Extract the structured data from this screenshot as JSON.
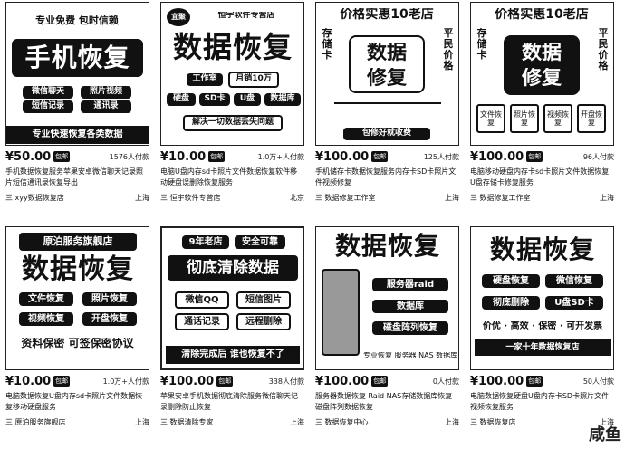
{
  "products": [
    {
      "thumb": {
        "top": "专业免费 包时信赖",
        "main": "手机恢复",
        "tags": [
          "微信聊天",
          "照片视频",
          "短信记录",
          "通讯录"
        ],
        "bottom": "专业快速恢复各类数据"
      },
      "price": "¥50.00",
      "badge": "包邮",
      "sold": "1576人付款",
      "title": "手机数据恢复服务苹果安卓微信聊天记录照片短信通讯录恢复导出",
      "shop": "三 xyy数据恢复店",
      "location": "上海"
    },
    {
      "thumb": {
        "logo": "宜聚",
        "shop": "恒宇软件专营店",
        "main": "数据恢复",
        "line1": "工作室",
        "line2": "月销10万",
        "tags": [
          "硬盘",
          "SD卡",
          "U盘",
          "数据库"
        ],
        "bottom": "解决一切数据丢失问题"
      },
      "price": "¥10.00",
      "badge": "包邮",
      "sold": "1.0万+人付款",
      "title": "电脑U盘内存sd卡照片文件数据恢复软件移动硬盘误删除恢复服务",
      "shop": "三 恒宇软件专营店",
      "location": "北京"
    },
    {
      "thumb": {
        "top": "价格实惠10老店",
        "left": "存储卡",
        "right": "平民价格",
        "main1": "数据",
        "main2": "修复",
        "bottom": "包修好就收费"
      },
      "price": "¥100.00",
      "badge": "包邮",
      "sold": "125人付款",
      "title": "手机储存卡数据恢复服务内存卡SD卡照片文件视频修复",
      "shop": "三 数据修复工作室",
      "location": "上海"
    },
    {
      "thumb": {
        "top": "价格实惠10老店",
        "left": "存储卡",
        "right": "平民价格",
        "main1": "数据",
        "main2": "修复",
        "tags": [
          "文件恢复",
          "照片恢复",
          "视频恢复",
          "开盘恢复"
        ]
      },
      "price": "¥100.00",
      "badge": "包邮",
      "sold": "96人付款",
      "title": "电脑移动硬盘内存卡sd卡照片文件数据恢复U盘存储卡修复服务",
      "shop": "三 数据修复工作室",
      "location": "上海"
    },
    {
      "thumb": {
        "top": "原泊服务旗舰店",
        "main": "数据恢复",
        "tags": [
          "文件恢复",
          "照片恢复",
          "视频恢复",
          "开盘恢复"
        ],
        "bottom": "资料保密 可签保密协议"
      },
      "price": "¥10.00",
      "badge": "包邮",
      "sold": "1.0万+人付款",
      "title": "电脑数据恢复U盘内存sd卡照片文件数据恢复移动硬盘服务",
      "shop": "三 原泊服务旗舰店",
      "location": "上海"
    },
    {
      "thumb": {
        "top1": "9年老店",
        "top2": "安全可靠",
        "main": "彻底清除数据",
        "tags": [
          "微信QQ",
          "短信图片",
          "通话记录",
          "远程删除"
        ],
        "bottom": "清除完成后 谁也恢复不了"
      },
      "price": "¥100.00",
      "badge": "包邮",
      "sold": "338人付款",
      "title": "苹果安卓手机数据彻底清除服务微信聊天记录删除防止恢复",
      "shop": "三 数据清除专家",
      "location": "上海"
    },
    {
      "thumb": {
        "main": "数据恢复",
        "tags": [
          "服务器raid",
          "数据库",
          "磁盘阵列恢复"
        ],
        "bottom": "专业恢复 服务器 NAS 数据库"
      },
      "price": "¥100.00",
      "badge": "包邮",
      "sold": "0人付款",
      "title": "服务器数据恢复 Raid NAS存储数据库恢复磁盘阵列数据恢复",
      "shop": "三 数据恢复中心",
      "location": "上海"
    },
    {
      "thumb": {
        "main": "数据恢复",
        "tags": [
          "硬盘恢复",
          "微信恢复",
          "彻底删除",
          "U盘SD卡"
        ],
        "line": "价优 · 高效 · 保密 · 可开发票",
        "bottom": "一家十年数据恢复店"
      },
      "price": "¥100.00",
      "badge": "包邮",
      "sold": "50人付款",
      "title": "电脑数据恢复硬盘U盘内存卡SD卡照片文件视频恢复服务",
      "shop": "三 数据恢复店",
      "location": "上海"
    }
  ],
  "watermark": "咸鱼"
}
